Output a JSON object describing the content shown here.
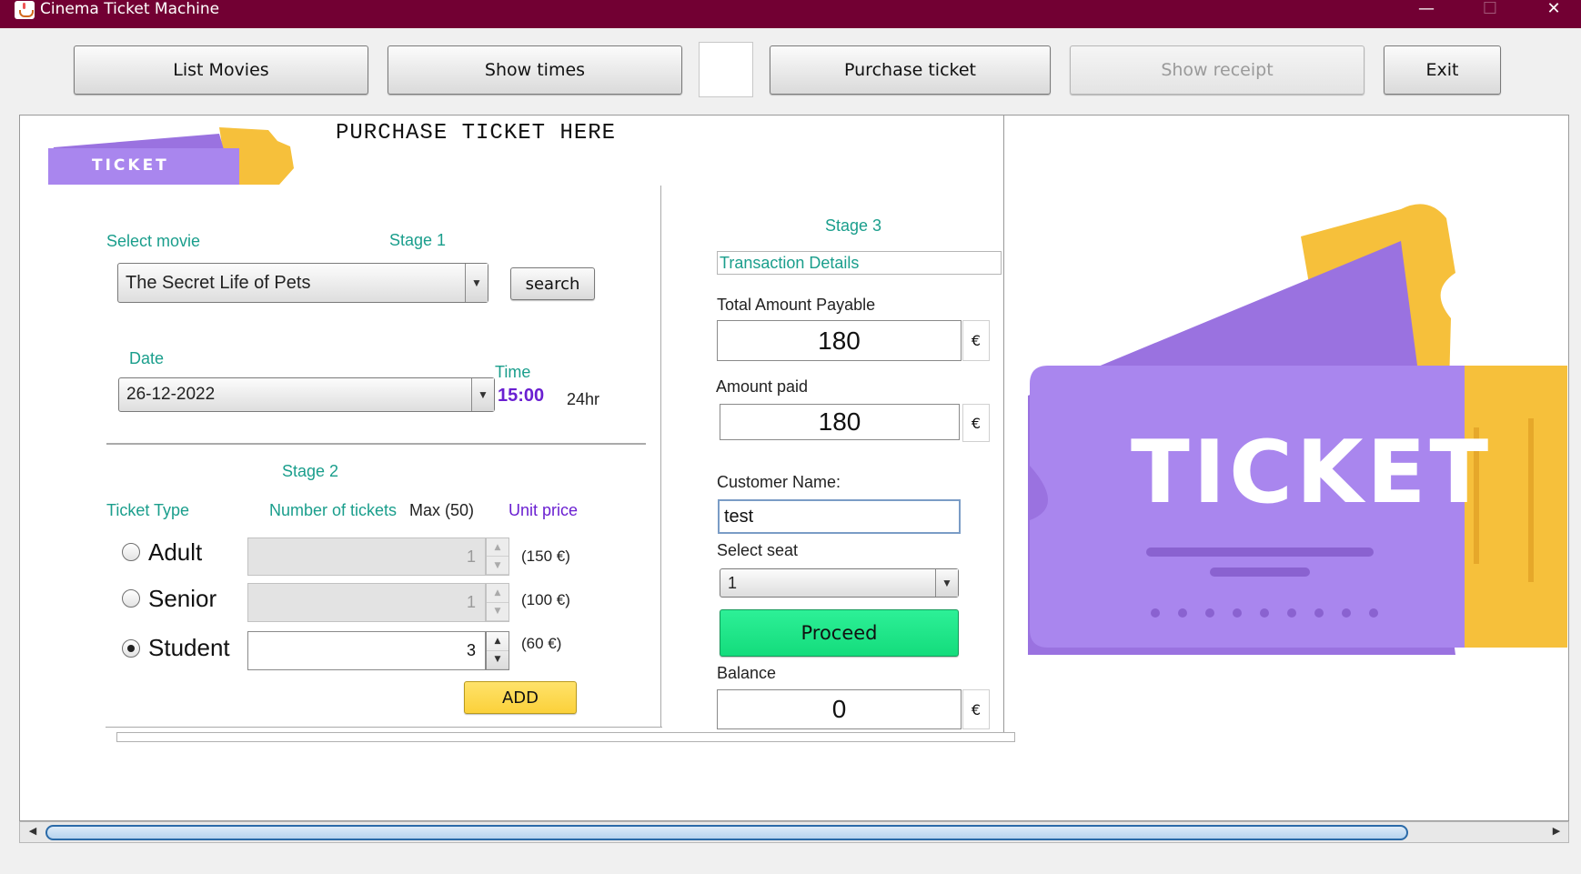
{
  "window": {
    "title": "Cinema Ticket Machine",
    "minimize": "—",
    "maximize": "☐",
    "close": "✕"
  },
  "toolbar": {
    "list_movies": "List Movies",
    "show_times": "Show times",
    "purchase_ticket": "Purchase ticket",
    "show_receipt": "Show receipt",
    "exit": "Exit"
  },
  "header": {
    "title": "PURCHASE TICKET HERE",
    "logo_text": "TICKET"
  },
  "stage1": {
    "label": "Stage 1",
    "select_movie_label": "Select movie",
    "movie_selected": "The Secret Life of Pets",
    "search_label": "search",
    "date_label": "Date",
    "date_selected": "26-12-2022",
    "time_label": "Time",
    "time_value": "15:00",
    "time_format": "24hr"
  },
  "stage2": {
    "label": "Stage 2",
    "ticket_type_label": "Ticket Type",
    "number_of_tickets_label": "Number of tickets",
    "max_label": "Max (50)",
    "unit_price_label": "Unit price",
    "tickets": [
      {
        "type": "Adult",
        "count": "1",
        "price": "(150 €)",
        "selected": false
      },
      {
        "type": "Senior",
        "count": "1",
        "price": "(100 €)",
        "selected": false
      },
      {
        "type": "Student",
        "count": "3",
        "price": "(60 €)",
        "selected": true
      }
    ],
    "add_label": "ADD"
  },
  "stage3": {
    "label": "Stage 3",
    "transaction_details_label": "Transaction  Details",
    "total_amount_label": "Total Amount Payable",
    "total_amount": "180",
    "amount_paid_label": "Amount paid",
    "amount_paid": "180",
    "currency": "€",
    "customer_name_label": "Customer Name:",
    "customer_name": "test",
    "select_seat_label": "Select seat",
    "seat_selected": "1",
    "proceed_label": "Proceed",
    "balance_label": "Balance",
    "balance": "0"
  },
  "illustration": {
    "text": "TICKET"
  },
  "colors": {
    "title_bar": "#720033",
    "teal_label": "#1a9e8c",
    "purple_time": "#6a1fd1",
    "proceed_green": "#1fe586",
    "add_yellow": "#ffd84a"
  }
}
